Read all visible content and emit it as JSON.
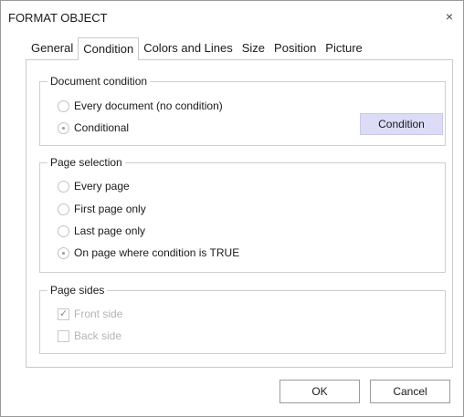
{
  "window": {
    "title": "FORMAT OBJECT",
    "close_glyph": "×"
  },
  "tabs": [
    {
      "label": "General"
    },
    {
      "label": "Condition",
      "active": true
    },
    {
      "label": "Colors and Lines"
    },
    {
      "label": "Size"
    },
    {
      "label": "Position"
    },
    {
      "label": "Picture"
    }
  ],
  "document_condition": {
    "legend": "Document condition",
    "options": [
      {
        "label": "Every document (no condition)",
        "checked": false
      },
      {
        "label": "Conditional",
        "checked": true
      }
    ],
    "condition_button": "Condition"
  },
  "page_selection": {
    "legend": "Page selection",
    "options": [
      {
        "label": "Every page",
        "checked": false
      },
      {
        "label": "First page only",
        "checked": false
      },
      {
        "label": "Last page only",
        "checked": false
      },
      {
        "label": "On page where condition is TRUE",
        "checked": true
      }
    ]
  },
  "page_sides": {
    "legend": "Page sides",
    "options": [
      {
        "label": "Front side",
        "checked": true,
        "enabled": false
      },
      {
        "label": "Back side",
        "checked": false,
        "enabled": false
      }
    ]
  },
  "buttons": {
    "ok": "OK",
    "cancel": "Cancel"
  },
  "colors": {
    "accent_button": "#dcdcf6",
    "disabled_text": "#b4b4b4"
  }
}
